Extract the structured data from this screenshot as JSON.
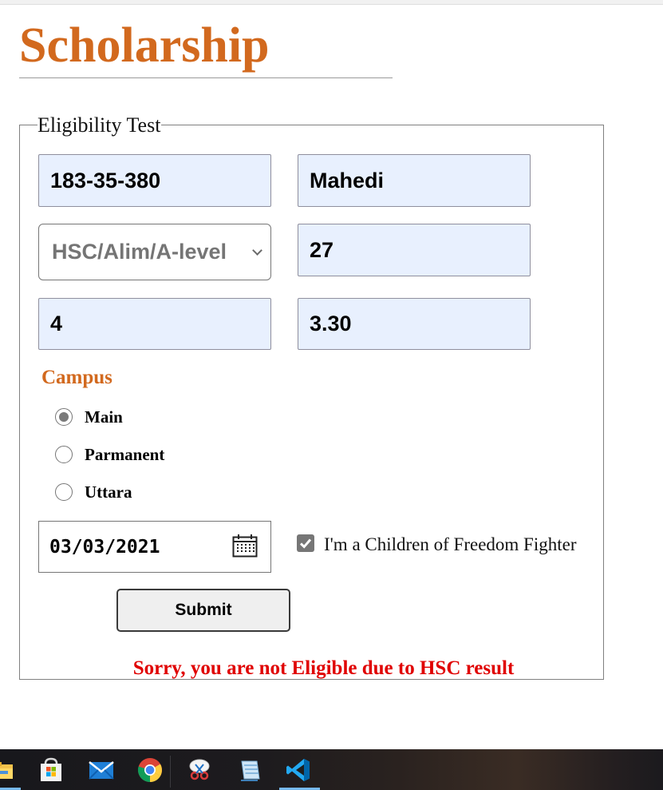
{
  "page": {
    "title": "Scholarship"
  },
  "form": {
    "legend": "Eligibility Test",
    "student_id": "183-35-380",
    "student_name": "Mahedi",
    "exam_select": "HSC/Alim/A-level",
    "field_27": "27",
    "field_4": "4",
    "gpa": "3.30",
    "campus": {
      "label": "Campus",
      "options": [
        {
          "label": "Main",
          "checked": true
        },
        {
          "label": "Parmanent",
          "checked": false
        },
        {
          "label": "Uttara",
          "checked": false
        }
      ]
    },
    "date": "03/03/2021",
    "freedom_fighter_label": "I'm a Children of Freedom Fighter",
    "freedom_fighter_checked": true,
    "submit_label": "Submit",
    "result_message": "Sorry, you are not Eligible due to HSC result"
  },
  "colors": {
    "accent": "#d2691e",
    "error": "#e00000",
    "autofill": "#e8f0fe"
  },
  "taskbar": {
    "icons": [
      "file-explorer-icon",
      "store-icon",
      "mail-icon",
      "chrome-icon",
      "snipping-tool-icon",
      "notepad-icon",
      "vscode-icon"
    ]
  }
}
